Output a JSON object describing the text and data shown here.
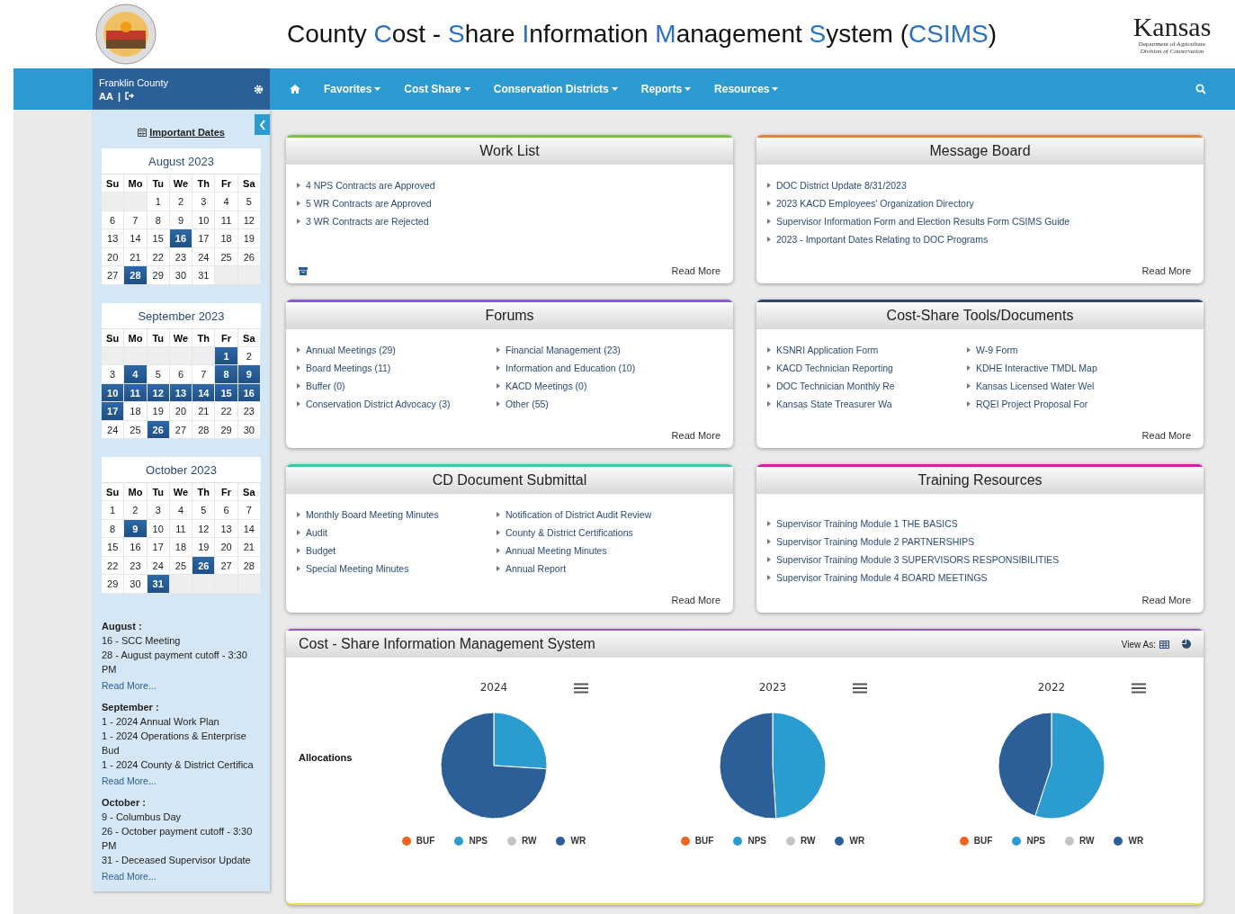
{
  "header": {
    "title": [
      {
        "text": "County ",
        "accent": false
      },
      {
        "text": "C",
        "accent": true
      },
      {
        "text": "ost - ",
        "accent": false
      },
      {
        "text": "S",
        "accent": true
      },
      {
        "text": "hare ",
        "accent": false
      },
      {
        "text": "I",
        "accent": true
      },
      {
        "text": "nformation ",
        "accent": false
      },
      {
        "text": "M",
        "accent": true
      },
      {
        "text": "anagement ",
        "accent": false
      },
      {
        "text": "S",
        "accent": true
      },
      {
        "text": "ystem (",
        "accent": false
      },
      {
        "text": "CSIMS",
        "accent": true
      },
      {
        "text": ")",
        "accent": false
      }
    ],
    "brand": {
      "name": "Kansas",
      "line1": "Department of Agriculture",
      "line2": "Division of Conservation"
    }
  },
  "user": {
    "county": "Franklin County",
    "initials": "AA",
    "separator": "|"
  },
  "nav": [
    "Favorites",
    "Cost Share",
    "Conservation Districts",
    "Reports",
    "Resources"
  ],
  "sidebar": {
    "important_dates": "Important Dates",
    "calendars": [
      {
        "title": "August 2023",
        "weekdays": [
          "Su",
          "Mo",
          "Tu",
          "We",
          "Th",
          "Fr",
          "Sa"
        ],
        "weeks": [
          [
            {
              "kind": "empty"
            },
            {
              "kind": "empty"
            },
            {
              "day": "1",
              "selected": false
            },
            {
              "day": "2",
              "selected": false
            },
            {
              "day": "3",
              "selected": false
            },
            {
              "day": "4",
              "selected": false
            },
            {
              "day": "5",
              "selected": false
            }
          ],
          [
            {
              "day": "6",
              "selected": false
            },
            {
              "day": "7",
              "selected": false
            },
            {
              "day": "8",
              "selected": false
            },
            {
              "day": "9",
              "selected": false
            },
            {
              "day": "10",
              "selected": false
            },
            {
              "day": "11",
              "selected": false
            },
            {
              "day": "12",
              "selected": false
            }
          ],
          [
            {
              "day": "13",
              "selected": false
            },
            {
              "day": "14",
              "selected": false
            },
            {
              "day": "15",
              "selected": false
            },
            {
              "day": "16",
              "selected": true
            },
            {
              "day": "17",
              "selected": false
            },
            {
              "day": "18",
              "selected": false
            },
            {
              "day": "19",
              "selected": false
            }
          ],
          [
            {
              "day": "20",
              "selected": false
            },
            {
              "day": "21",
              "selected": false
            },
            {
              "day": "22",
              "selected": false
            },
            {
              "day": "23",
              "selected": false
            },
            {
              "day": "24",
              "selected": false
            },
            {
              "day": "25",
              "selected": false
            },
            {
              "day": "26",
              "selected": false
            }
          ],
          [
            {
              "day": "27",
              "selected": false
            },
            {
              "day": "28",
              "selected": true
            },
            {
              "day": "29",
              "selected": false
            },
            {
              "day": "30",
              "selected": false
            },
            {
              "day": "31",
              "selected": false
            },
            {
              "kind": "empty"
            },
            {
              "kind": "empty"
            }
          ]
        ]
      },
      {
        "title": "September 2023",
        "weekdays": [
          "Su",
          "Mo",
          "Tu",
          "We",
          "Th",
          "Fr",
          "Sa"
        ],
        "weeks": [
          [
            {
              "kind": "empty"
            },
            {
              "kind": "empty"
            },
            {
              "kind": "empty"
            },
            {
              "kind": "empty"
            },
            {
              "kind": "empty"
            },
            {
              "day": "1",
              "selected": true
            },
            {
              "day": "2",
              "selected": false
            }
          ],
          [
            {
              "day": "3",
              "selected": false
            },
            {
              "day": "4",
              "selected": true
            },
            {
              "day": "5",
              "selected": false
            },
            {
              "day": "6",
              "selected": false
            },
            {
              "day": "7",
              "selected": false
            },
            {
              "day": "8",
              "selected": true
            },
            {
              "day": "9",
              "selected": true
            }
          ],
          [
            {
              "day": "10",
              "selected": true
            },
            {
              "day": "11",
              "selected": true
            },
            {
              "day": "12",
              "selected": true
            },
            {
              "day": "13",
              "selected": true
            },
            {
              "day": "14",
              "selected": true
            },
            {
              "day": "15",
              "selected": true
            },
            {
              "day": "16",
              "selected": true
            }
          ],
          [
            {
              "day": "17",
              "selected": true
            },
            {
              "day": "18",
              "selected": false
            },
            {
              "day": "19",
              "selected": false
            },
            {
              "day": "20",
              "selected": false
            },
            {
              "day": "21",
              "selected": false
            },
            {
              "day": "22",
              "selected": false
            },
            {
              "day": "23",
              "selected": false
            }
          ],
          [
            {
              "day": "24",
              "selected": false
            },
            {
              "day": "25",
              "selected": false
            },
            {
              "day": "26",
              "selected": true
            },
            {
              "day": "27",
              "selected": false
            },
            {
              "day": "28",
              "selected": false
            },
            {
              "day": "29",
              "selected": false
            },
            {
              "day": "30",
              "selected": false
            }
          ]
        ]
      },
      {
        "title": "October 2023",
        "weekdays": [
          "Su",
          "Mo",
          "Tu",
          "We",
          "Th",
          "Fr",
          "Sa"
        ],
        "weeks": [
          [
            {
              "day": "1",
              "selected": false
            },
            {
              "day": "2",
              "selected": false
            },
            {
              "day": "3",
              "selected": false
            },
            {
              "day": "4",
              "selected": false
            },
            {
              "day": "5",
              "selected": false
            },
            {
              "day": "6",
              "selected": false
            },
            {
              "day": "7",
              "selected": false
            }
          ],
          [
            {
              "day": "8",
              "selected": false
            },
            {
              "day": "9",
              "selected": true
            },
            {
              "day": "10",
              "selected": false
            },
            {
              "day": "11",
              "selected": false
            },
            {
              "day": "12",
              "selected": false
            },
            {
              "day": "13",
              "selected": false
            },
            {
              "day": "14",
              "selected": false
            }
          ],
          [
            {
              "day": "15",
              "selected": false
            },
            {
              "day": "16",
              "selected": false
            },
            {
              "day": "17",
              "selected": false
            },
            {
              "day": "18",
              "selected": false
            },
            {
              "day": "19",
              "selected": false
            },
            {
              "day": "20",
              "selected": false
            },
            {
              "day": "21",
              "selected": false
            }
          ],
          [
            {
              "day": "22",
              "selected": false
            },
            {
              "day": "23",
              "selected": false
            },
            {
              "day": "24",
              "selected": false
            },
            {
              "day": "25",
              "selected": false
            },
            {
              "day": "26",
              "selected": true
            },
            {
              "day": "27",
              "selected": false
            },
            {
              "day": "28",
              "selected": false
            }
          ],
          [
            {
              "day": "29",
              "selected": false
            },
            {
              "day": "30",
              "selected": false
            },
            {
              "day": "31",
              "selected": true
            },
            {
              "kind": "empty"
            },
            {
              "kind": "empty"
            },
            {
              "kind": "empty"
            },
            {
              "kind": "empty"
            }
          ]
        ]
      }
    ],
    "events": [
      {
        "heading": "August :",
        "items": [
          "16 - SCC Meeting",
          "28 - August payment cutoff - 3:30 PM"
        ],
        "more": "Read More..."
      },
      {
        "heading": "September :",
        "items": [
          "1 - 2024 Annual Work Plan",
          "1 - 2024 Operations & Enterprise Bud",
          "1 - 2024 County & District Certifica"
        ],
        "more": "Read More..."
      },
      {
        "heading": "October :",
        "items": [
          "9 - Columbus Day",
          "26 - October payment cutoff - 3:30 PM",
          "31 - Deceased Supervisor Update"
        ],
        "more": "Read More..."
      }
    ]
  },
  "cards": [
    {
      "title": "Work List",
      "color": "#7cc242",
      "archive": true,
      "columns": [
        [
          "4 NPS Contracts are Approved",
          "5 WR Contracts are Approved",
          "3 WR Contracts are Rejected"
        ]
      ],
      "more": "Read More"
    },
    {
      "title": "Message Board",
      "color": "#e8823a",
      "archive": false,
      "columns": [
        [
          "DOC District Update 8/31/2023",
          "2023 KACD Employees' Organization Directory",
          "Supervisor Information Form and Election Results Form CSIMS Guide",
          "2023 - Important Dates Relating to DOC Programs"
        ]
      ],
      "more": "Read More"
    },
    {
      "title": "Forums",
      "color": "#8b5cd6",
      "archive": false,
      "columns": [
        [
          "Annual Meetings (29)",
          "Board Meetings (11)",
          "Buffer (0)",
          "Conservation District Advocacy (3)"
        ],
        [
          "Financial Management (23)",
          "Information and Education (10)",
          "KACD Meetings (0)",
          "Other (55)"
        ]
      ],
      "more": "Read More"
    },
    {
      "title": "Cost-Share Tools/Documents",
      "color": "#2d4a6b",
      "archive": false,
      "columns": [
        [
          "KSNRI Application Form",
          "KACD Technician Reporting",
          "DOC Technician Monthly Re",
          "Kansas State Treasurer Wa"
        ],
        [
          "W-9 Form",
          "KDHE Interactive TMDL Map",
          "Kansas Licensed Water Wel",
          "RQEI Project Proposal For"
        ]
      ],
      "more": "Read More"
    },
    {
      "title": "CD Document Submittal",
      "color": "#3cc7a8",
      "archive": false,
      "columns": [
        [
          "Monthly Board Meeting Minutes",
          "Audit",
          "Budget",
          "Special Meeting Minutes"
        ],
        [
          "Notification of District Audit Review",
          "County & District Certifications",
          "Annual Meeting Minutes",
          "Annual Report"
        ]
      ],
      "more": "Read More"
    },
    {
      "title": "Training Resources",
      "color": "#d81ba8",
      "archive": false,
      "columns": [
        [
          "Supervisor Training Module 1 THE BASICS",
          "Supervisor Training Module 2 PARTNERSHIPS",
          "Supervisor Training Module 3 SUPERVISORS RESPONSIBILITIES",
          "Supervisor Training Module 4 BOARD MEETINGS"
        ]
      ],
      "more": "Read More"
    }
  ],
  "summary": {
    "title": "Cost - Share Information Management System",
    "view_as": "View As:",
    "row_label": "Allocations",
    "charts": [
      {
        "title": "2024",
        "legend": [
          {
            "label": "BUF",
            "color": "#f26522"
          },
          {
            "label": "NPS",
            "color": "#2a9ccf"
          },
          {
            "label": "RW",
            "color": "#c4c4c4"
          },
          {
            "label": "WR",
            "color": "#2c5f98"
          }
        ]
      },
      {
        "title": "2023",
        "legend": [
          {
            "label": "BUF",
            "color": "#f26522"
          },
          {
            "label": "NPS",
            "color": "#2a9ccf"
          },
          {
            "label": "RW",
            "color": "#c4c4c4"
          },
          {
            "label": "WR",
            "color": "#2c5f98"
          }
        ]
      },
      {
        "title": "2022",
        "legend": [
          {
            "label": "BUF",
            "color": "#f26522"
          },
          {
            "label": "NPS",
            "color": "#2a9ccf"
          },
          {
            "label": "RW",
            "color": "#c4c4c4"
          },
          {
            "label": "WR",
            "color": "#2c5f98"
          }
        ]
      }
    ]
  }
}
